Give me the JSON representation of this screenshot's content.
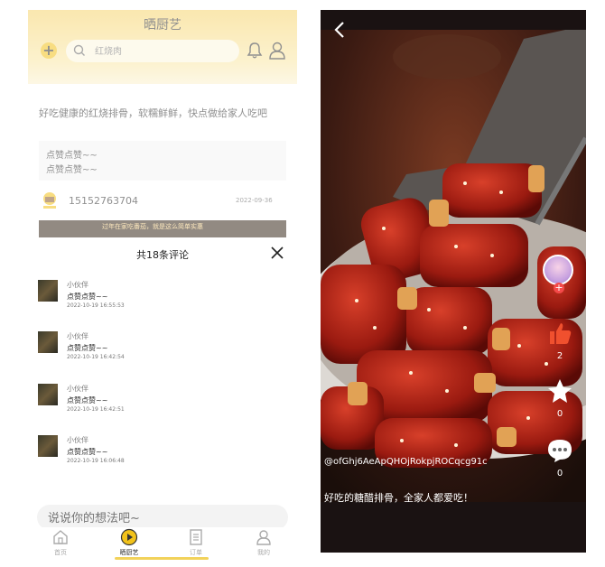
{
  "left_screen": {
    "header": {
      "title": "晒厨艺",
      "search_placeholder": "红烧肉"
    },
    "post": {
      "text": "好吃健康的红烧排骨，软糯鲜鲜，快点做给家人吃吧",
      "comment_preview": [
        "点赞点赞~~",
        "点赞点赞~~"
      ],
      "author": "15152763704",
      "time": "2022-09-36",
      "image_banner_text": "过年在家吃番茄，就是这么简单实惠"
    },
    "comments_sheet": {
      "title": "共18条评论",
      "comments": [
        {
          "user": "小伙伴",
          "text": "点赞点赞~~",
          "time": "2022-10-19 16:55:53"
        },
        {
          "user": "小伙伴",
          "text": "点赞点赞~~",
          "time": "2022-10-19 16:42:54"
        },
        {
          "user": "小伙伴",
          "text": "点赞点赞~~",
          "time": "2022-10-19 16:42:51"
        },
        {
          "user": "小伙伴",
          "text": "点赞点赞~~",
          "time": "2022-10-19 16:06:48"
        }
      ],
      "input_placeholder": "说说你的想法吧~"
    },
    "tabs": [
      {
        "label": "首页",
        "icon": "home-icon",
        "active": false
      },
      {
        "label": "晒厨艺",
        "icon": "play-circle-icon",
        "active": true
      },
      {
        "label": "订单",
        "icon": "order-list-icon",
        "active": false
      },
      {
        "label": "我的",
        "icon": "profile-icon",
        "active": false
      }
    ],
    "colors": {
      "accent": "#f2c21a",
      "header": "#f6d46e"
    }
  },
  "right_screen": {
    "user_handle": "@ofGhj6AeApQHOjRokpjROCqcg91c",
    "caption": "好吃的糖醋排骨，全家人都爱吃！",
    "likes": "2",
    "favorites": "0",
    "comments": "0",
    "colors": {
      "like": "#f0502e"
    }
  }
}
